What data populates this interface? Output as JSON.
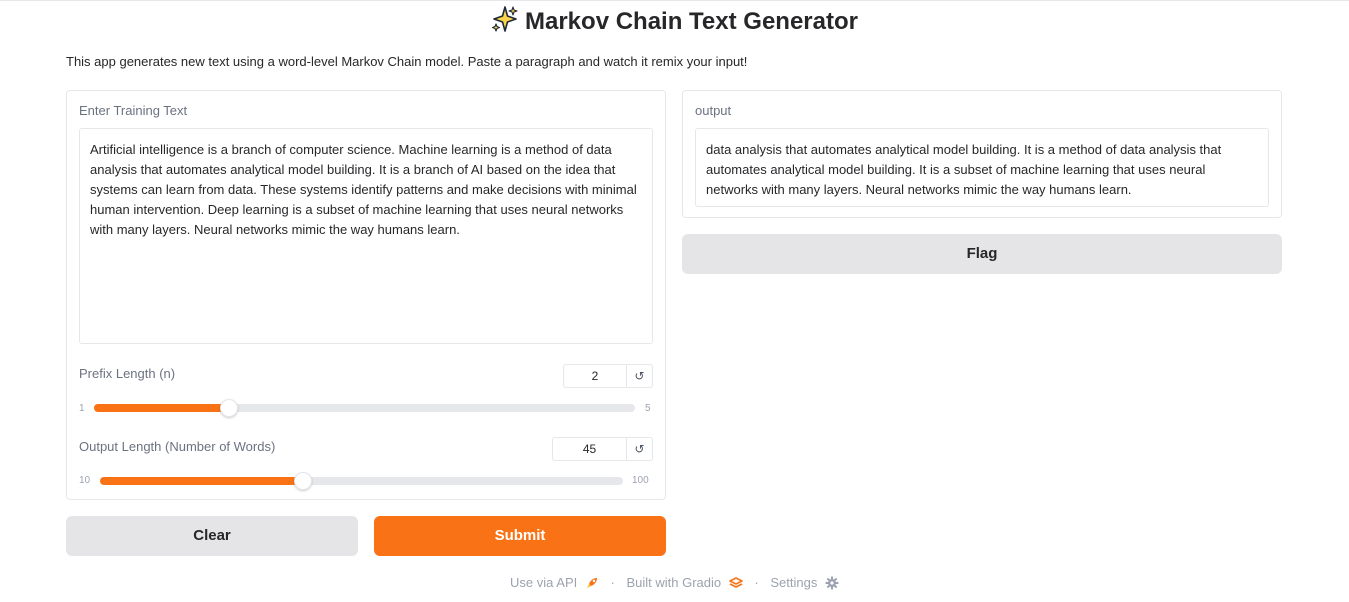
{
  "header": {
    "title": "Markov Chain Text Generator",
    "title_icon": "sparkles-icon",
    "description": "This app generates new text using a word-level Markov Chain model. Paste a paragraph and watch it remix your input!"
  },
  "input_panel": {
    "training_label": "Enter Training Text",
    "training_text": "Artificial intelligence is a branch of computer science. Machine learning is a method of data analysis that automates analytical model building. It is a branch of AI based on the idea that systems can learn from data. These systems identify patterns and make decisions with minimal human intervention. Deep learning is a subset of machine learning that uses neural networks with many layers. Neural networks mimic the way humans learn.",
    "prefix_slider": {
      "label": "Prefix Length (n)",
      "value": "2",
      "min": "1",
      "max": "5",
      "reset_icon": "reset-icon"
    },
    "output_slider": {
      "label": "Output Length (Number of Words)",
      "value": "45",
      "min": "10",
      "max": "100",
      "reset_icon": "reset-icon"
    }
  },
  "buttons": {
    "clear": "Clear",
    "submit": "Submit",
    "flag": "Flag"
  },
  "output_panel": {
    "label": "output",
    "text": "data analysis that automates analytical model building. It is a method of data analysis that automates analytical model building. It is a subset of machine learning that uses neural networks with many layers. Neural networks mimic the way humans learn."
  },
  "footer": {
    "api": "Use via API",
    "api_icon": "rocket-icon",
    "built": "Built with Gradio",
    "built_icon": "gradio-logo-icon",
    "settings": "Settings",
    "settings_icon": "gear-icon",
    "separator": "·"
  },
  "colors": {
    "accent": "#f97316",
    "secondary_button": "#e5e5e7",
    "border": "#e5e7eb"
  }
}
